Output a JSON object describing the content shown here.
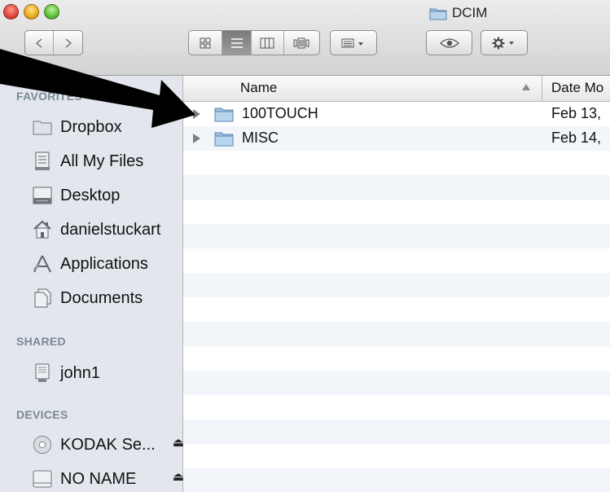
{
  "window": {
    "title": "DCIM"
  },
  "sidebar": {
    "favorites_header": "FAVORITES",
    "favorites": [
      {
        "label": "Dropbox",
        "icon": "folder-icon"
      },
      {
        "label": "All My Files",
        "icon": "all-files-icon"
      },
      {
        "label": "Desktop",
        "icon": "desktop-icon"
      },
      {
        "label": "danielstuckart",
        "icon": "home-icon"
      },
      {
        "label": "Applications",
        "icon": "applications-icon"
      },
      {
        "label": "Documents",
        "icon": "documents-icon"
      }
    ],
    "shared_header": "SHARED",
    "shared": [
      {
        "label": "john1",
        "icon": "computer-icon"
      }
    ],
    "devices_header": "DEVICES",
    "devices": [
      {
        "label": "KODAK Se...",
        "icon": "disc-icon",
        "eject": "⏏"
      },
      {
        "label": "NO NAME",
        "icon": "drive-icon",
        "eject": "⏏"
      }
    ]
  },
  "columns": {
    "name": "Name",
    "date": "Date Mo"
  },
  "files": [
    {
      "name": "100TOUCH",
      "date": "Feb 13,"
    },
    {
      "name": "MISC",
      "date": "Feb 14,"
    }
  ]
}
